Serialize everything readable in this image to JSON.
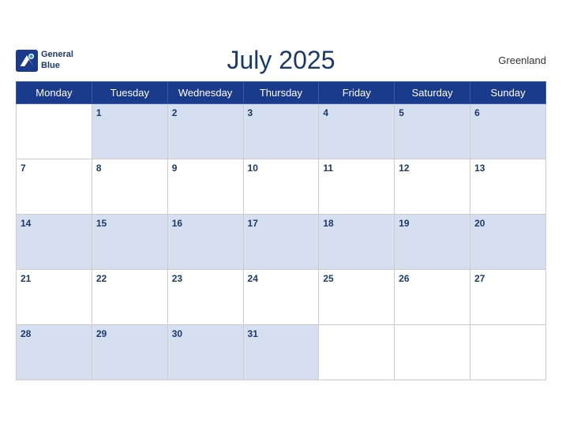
{
  "header": {
    "month_year": "July 2025",
    "region": "Greenland",
    "logo_line1": "General",
    "logo_line2": "Blue"
  },
  "weekdays": [
    "Monday",
    "Tuesday",
    "Wednesday",
    "Thursday",
    "Friday",
    "Saturday",
    "Sunday"
  ],
  "weeks": [
    [
      null,
      1,
      2,
      3,
      4,
      5,
      6
    ],
    [
      7,
      8,
      9,
      10,
      11,
      12,
      13
    ],
    [
      14,
      15,
      16,
      17,
      18,
      19,
      20
    ],
    [
      21,
      22,
      23,
      24,
      25,
      26,
      27
    ],
    [
      28,
      29,
      30,
      31,
      null,
      null,
      null
    ]
  ]
}
